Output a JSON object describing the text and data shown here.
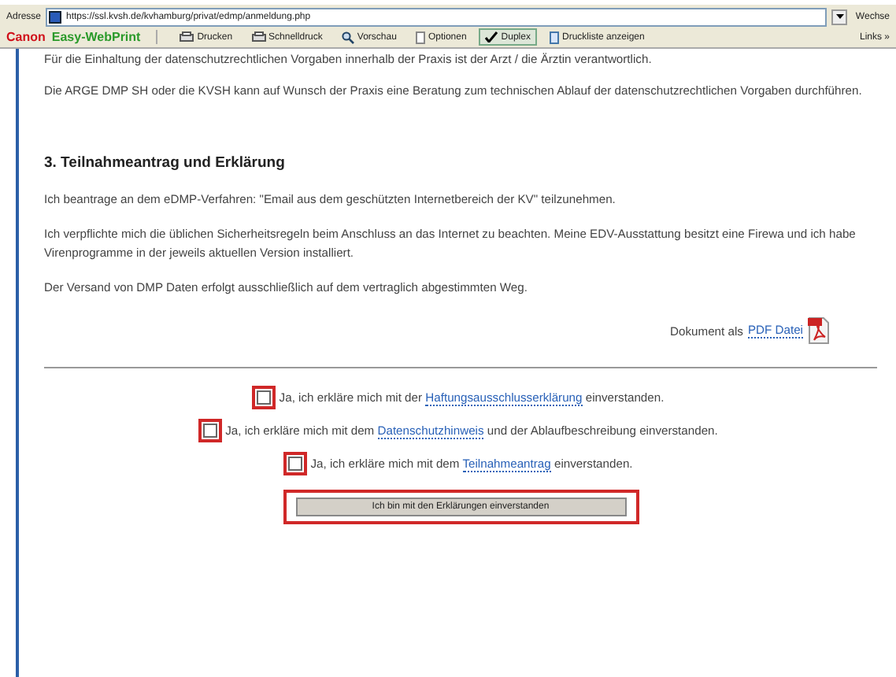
{
  "address_bar": {
    "label": "Adresse",
    "url": "https://ssl.kvsh.de/kvhamburg/privat/edmp/anmeldung.php",
    "go_label": "Wechse"
  },
  "toolbar": {
    "brand": "Canon",
    "product": "Easy-WebPrint",
    "items": [
      {
        "kind": "print",
        "label": "Drucken",
        "checked": false
      },
      {
        "kind": "quick",
        "label": "Schnelldruck",
        "checked": false
      },
      {
        "kind": "preview",
        "label": "Vorschau",
        "checked": false
      },
      {
        "kind": "options",
        "label": "Optionen",
        "checked": false
      },
      {
        "kind": "duplex",
        "label": "Duplex",
        "checked": true
      },
      {
        "kind": "list",
        "label": "Druckliste anzeigen",
        "checked": false
      }
    ],
    "links_label": "Links »"
  },
  "content": {
    "cut_top_line": "Für die Einhaltung der datenschutzrechtlichen Vorgaben innerhalb der Praxis ist der Arzt / die Ärztin verantwortlich.",
    "intro": "Die ARGE DMP SH oder die KVSH kann auf Wunsch der Praxis eine Beratung zum technischen Ablauf der datenschutzrechtlichen Vorgaben durchführen.",
    "heading": "3. Teilnahmeantrag und Erklärung",
    "paragraphs": [
      "Ich beantrage an dem eDMP-Verfahren: \"Email aus dem geschützten Internetbereich der KV\" teilzunehmen.",
      "Ich verpflichte mich die üblichen Sicherheitsregeln beim Anschluss an das Internet zu beachten. Meine EDV-Ausstattung besitzt eine Firewa und ich habe Virenprogramme in der jeweils aktuellen Version installiert.",
      "Der Versand von DMP Daten erfolgt ausschließlich auf dem vertraglich abgestimmten Weg."
    ],
    "pdf": {
      "text": "Dokument als",
      "link": "PDF Datei"
    },
    "declarations": [
      {
        "before": "Ja, ich erkläre mich mit der",
        "link": "Haftungsausschlusserklärung",
        "after": "einverstanden.",
        "checked": false
      },
      {
        "before": "Ja, ich erkläre mich mit dem",
        "link": "Datenschutzhinweis",
        "after": "und der Ablaufbeschreibung einverstanden.",
        "checked": false
      },
      {
        "before": "Ja, ich erkläre mich mit dem",
        "link": "Teilnahmeantrag",
        "after": "einverstanden.",
        "checked": false
      }
    ],
    "submit": "Ich bin mit den Erklärungen einverstanden"
  }
}
